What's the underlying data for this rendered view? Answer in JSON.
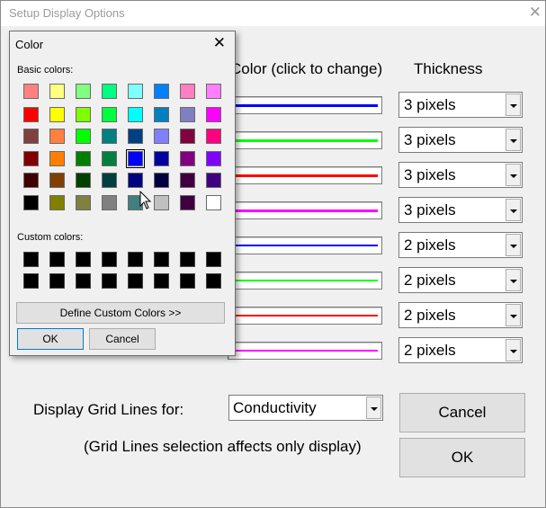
{
  "window": {
    "title": "Setup Display Options",
    "close_glyph": "✕"
  },
  "headers": {
    "color": "Color (click to change)",
    "thickness": "Thickness"
  },
  "rows": [
    {
      "line_color": "#0000ff",
      "thickness": "3 pixels"
    },
    {
      "line_color": "#00ff00",
      "thickness": "3 pixels"
    },
    {
      "line_color": "#ff0000",
      "thickness": "3 pixels"
    },
    {
      "line_color": "#ff00ff",
      "thickness": "3 pixels"
    },
    {
      "line_color": "#0000ff",
      "thickness": "2 pixels"
    },
    {
      "line_color": "#00ff00",
      "thickness": "2 pixels"
    },
    {
      "line_color": "#ff0000",
      "thickness": "2 pixels"
    },
    {
      "line_color": "#ff00ff",
      "thickness": "2 pixels"
    }
  ],
  "grid": {
    "label": "Display Grid Lines for:",
    "selected": "Conductivity",
    "note": "(Grid Lines selection affects only display)"
  },
  "buttons": {
    "cancel": "Cancel",
    "ok": "OK"
  },
  "color_dialog": {
    "title": "Color",
    "close_glyph": "✕",
    "basic_label": "Basic colors:",
    "custom_label": "Custom colors:",
    "define_button": "Define Custom Colors >>",
    "ok": "OK",
    "cancel": "Cancel",
    "basic_colors": [
      "#ff8080",
      "#ffff80",
      "#80ff80",
      "#00ff80",
      "#80ffff",
      "#0080ff",
      "#ff80c0",
      "#ff80ff",
      "#ff0000",
      "#ffff00",
      "#80ff00",
      "#00ff40",
      "#00ffff",
      "#0080c0",
      "#8080c0",
      "#ff00ff",
      "#804040",
      "#ff8040",
      "#00ff00",
      "#008080",
      "#004080",
      "#8080ff",
      "#800040",
      "#ff0080",
      "#800000",
      "#ff8000",
      "#008000",
      "#008040",
      "#0000ff",
      "#0000a0",
      "#800080",
      "#8000ff",
      "#400000",
      "#804000",
      "#004000",
      "#004040",
      "#000080",
      "#000040",
      "#400040",
      "#400080",
      "#000000",
      "#808000",
      "#808040",
      "#808080",
      "#408080",
      "#c0c0c0",
      "#400040",
      "#ffffff"
    ],
    "selected_index": 28,
    "custom_colors": [
      "#000000",
      "#000000",
      "#000000",
      "#000000",
      "#000000",
      "#000000",
      "#000000",
      "#000000",
      "#000000",
      "#000000",
      "#000000",
      "#000000",
      "#000000",
      "#000000",
      "#000000",
      "#000000"
    ]
  }
}
